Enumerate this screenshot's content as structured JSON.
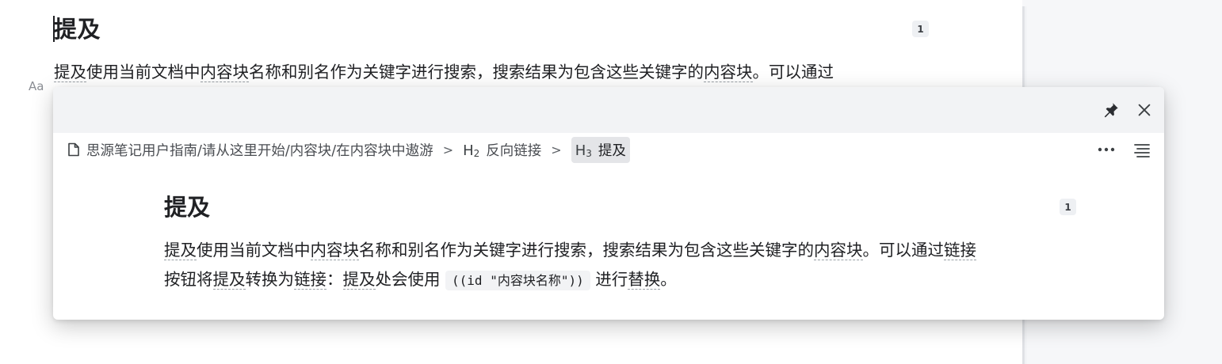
{
  "editor": {
    "heading": "提及",
    "heading_ref_count": "1",
    "paragraph": [
      {
        "text": "提及",
        "ref": true
      },
      {
        "text": "使用当前文档中",
        "ref": false
      },
      {
        "text": "内容块",
        "ref": true
      },
      {
        "text": "名称和别名作为关键字进行搜索，搜索结果为包含这些关键字的",
        "ref": false
      },
      {
        "text": "内容块",
        "ref": true
      },
      {
        "text": "。可以通过",
        "ref": false
      }
    ],
    "font_toggle": "Aa"
  },
  "popover": {
    "pin_icon": "pin-icon",
    "close_icon": "close-icon",
    "breadcrumb": {
      "doc_icon": "document-icon",
      "path": "思源笔记用户指南/请从这里开始/内容块/在内容块中遨游",
      "separator": ">",
      "h2_prefix": "H",
      "h2_level": "2",
      "h2_label": "反向链接",
      "h3_prefix": "H",
      "h3_level": "3",
      "h3_label": "提及"
    },
    "more_icon": "more-icon",
    "outline_icon": "outline-icon",
    "heading": "提及",
    "heading_ref_count": "1",
    "line1": [
      {
        "text": "提及",
        "ref": true
      },
      {
        "text": "使用当前文档中",
        "ref": false
      },
      {
        "text": "内容块",
        "ref": true
      },
      {
        "text": "名称和别名作为关键字进行搜索，搜索结果为包含这些关键字的",
        "ref": false
      },
      {
        "text": "内容块",
        "ref": true
      },
      {
        "text": "。可以通过",
        "ref": false
      },
      {
        "text": "链接",
        "ref": true
      }
    ],
    "line2_parts": {
      "a": "按钮将",
      "b": "提及",
      "c": "转换为",
      "d": "链接",
      "e": "：",
      "f": "提及",
      "g": "处会使用 ",
      "code": "((id \"内容块名称\"))",
      "h": " 进行",
      "i": "替换",
      "j": "。"
    }
  },
  "colors": {
    "accent_bg": "#f2f3f5",
    "ref_underline": "#9aa0a6"
  }
}
